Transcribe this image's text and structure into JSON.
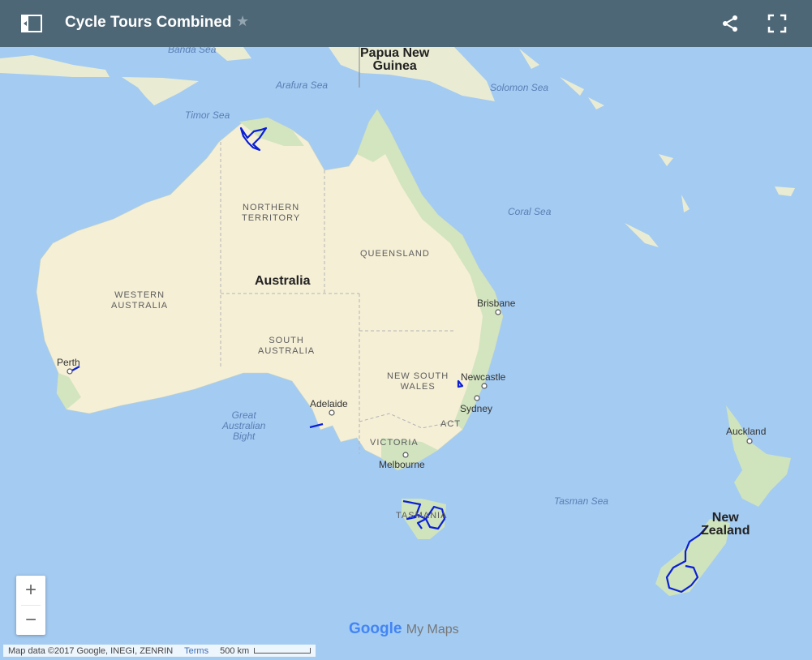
{
  "header": {
    "title": "Cycle Tours Combined",
    "icons": {
      "legend": "legend-toggle-icon",
      "star": "star-icon",
      "share": "share-icon",
      "fullscreen": "fullscreen-icon"
    }
  },
  "map": {
    "labels": {
      "banda_sea": "Banda Sea",
      "arafura_sea": "Arafura Sea",
      "timor_sea": "Timor Sea",
      "solomon_sea": "Solomon Sea",
      "coral_sea": "Coral Sea",
      "tasman_sea": "Tasman Sea",
      "great_australian_bight": "Great\nAustralian\nBight",
      "png": "Papua New\nGuinea",
      "australia": "Australia",
      "new_zealand": "New\nZealand",
      "northern_territory": "NORTHERN\nTERRITORY",
      "queensland": "QUEENSLAND",
      "western_australia": "WESTERN\nAUSTRALIA",
      "south_australia": "SOUTH\nAUSTRALIA",
      "nsw": "NEW SOUTH\nWALES",
      "act": "ACT",
      "victoria": "VICTORIA",
      "tasmania": "TASMANIA",
      "brisbane": "Brisbane",
      "perth": "Perth",
      "adelaide": "Adelaide",
      "newcastle": "Newcastle",
      "sydney": "Sydney",
      "melbourne": "Melbourne",
      "auckland": "Auckland"
    },
    "colors": {
      "water": "#a4cbf2",
      "land": "#f5efd6",
      "green": "#cfe3bd",
      "route": "#0a1fd6",
      "header": "#4e6776"
    }
  },
  "controls": {
    "zoom_in": "+",
    "zoom_out": "−"
  },
  "footer": {
    "attribution": "Map data ©2017 Google, INEGI, ZENRIN",
    "terms": "Terms",
    "scale": "500 km",
    "logo_google": "Google",
    "logo_mymaps": "My Maps"
  }
}
